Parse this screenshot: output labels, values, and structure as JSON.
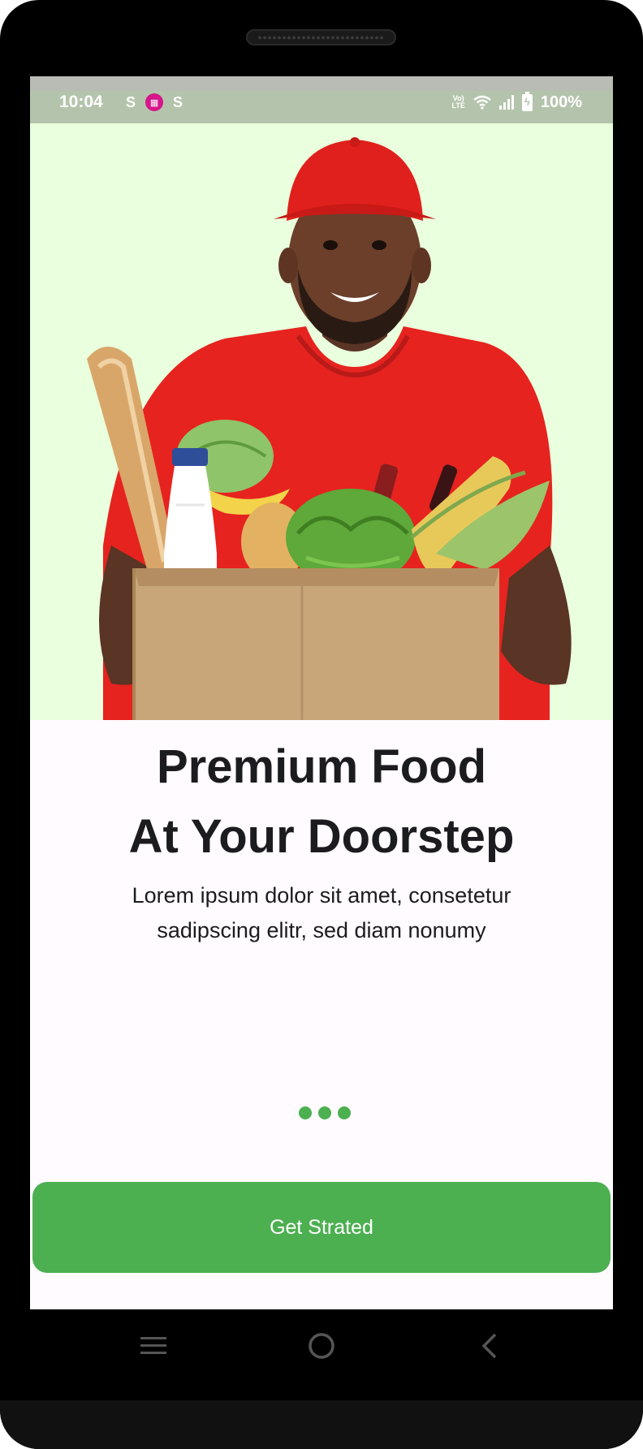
{
  "status_bar": {
    "time": "10:04",
    "battery": "100%",
    "left_icons": [
      "notification-s-icon",
      "calendar-app-icon",
      "notification-s-icon"
    ],
    "right_icons": [
      "volte-icon",
      "wifi-icon",
      "signal-icon",
      "battery-charging-icon"
    ],
    "volte_label_top": "Vo)",
    "volte_label_bottom": "LTE"
  },
  "hero": {
    "image": "delivery-man-with-grocery-box",
    "background_color": "#e9ffdd"
  },
  "onboarding": {
    "title_line1": "Premium Food",
    "title_line2": "At Your Doorstep",
    "description": "Lorem ipsum dolor sit amet, consetetur sadipscing elitr, sed diam nonumy",
    "page_indicator_count": 3,
    "indicator_color": "#4caf50"
  },
  "cta": {
    "label": "Get Strated",
    "color": "#4caf50"
  },
  "nav_bar": {
    "buttons": [
      "recents-icon",
      "home-icon",
      "back-icon"
    ]
  }
}
